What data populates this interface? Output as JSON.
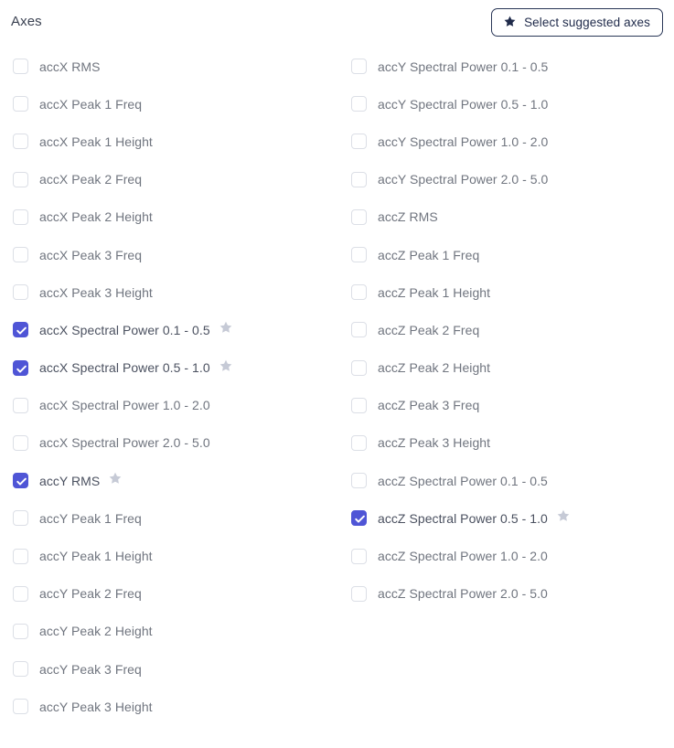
{
  "header": {
    "title": "Axes",
    "suggest_button": {
      "label": "Select suggested axes",
      "icon": "star-icon"
    }
  },
  "colors": {
    "checkbox_checked": "#4f55d6",
    "checkbox_border": "#dcdfe6",
    "label_text": "#70757f",
    "title_text": "#3b4252",
    "button_border": "#2a3757",
    "button_text": "#1f2a4a",
    "star_suggested": "#c6cad6",
    "background": "#ffffff"
  },
  "columns": [
    {
      "name": "left-column",
      "items": [
        {
          "label": "accX RMS",
          "checked": false,
          "suggested": false
        },
        {
          "label": "accX Peak 1 Freq",
          "checked": false,
          "suggested": false
        },
        {
          "label": "accX Peak 1 Height",
          "checked": false,
          "suggested": false
        },
        {
          "label": "accX Peak 2 Freq",
          "checked": false,
          "suggested": false
        },
        {
          "label": "accX Peak 2 Height",
          "checked": false,
          "suggested": false
        },
        {
          "label": "accX Peak 3 Freq",
          "checked": false,
          "suggested": false
        },
        {
          "label": "accX Peak 3 Height",
          "checked": false,
          "suggested": false
        },
        {
          "label": "accX Spectral Power 0.1 - 0.5",
          "checked": true,
          "suggested": true
        },
        {
          "label": "accX Spectral Power 0.5 - 1.0",
          "checked": true,
          "suggested": true
        },
        {
          "label": "accX Spectral Power 1.0 - 2.0",
          "checked": false,
          "suggested": false
        },
        {
          "label": "accX Spectral Power 2.0 - 5.0",
          "checked": false,
          "suggested": false
        },
        {
          "label": "accY RMS",
          "checked": true,
          "suggested": true
        },
        {
          "label": "accY Peak 1 Freq",
          "checked": false,
          "suggested": false
        },
        {
          "label": "accY Peak 1 Height",
          "checked": false,
          "suggested": false
        },
        {
          "label": "accY Peak 2 Freq",
          "checked": false,
          "suggested": false
        },
        {
          "label": "accY Peak 2 Height",
          "checked": false,
          "suggested": false
        },
        {
          "label": "accY Peak 3 Freq",
          "checked": false,
          "suggested": false
        },
        {
          "label": "accY Peak 3 Height",
          "checked": false,
          "suggested": false
        }
      ]
    },
    {
      "name": "right-column",
      "items": [
        {
          "label": "accY Spectral Power 0.1 - 0.5",
          "checked": false,
          "suggested": false
        },
        {
          "label": "accY Spectral Power 0.5 - 1.0",
          "checked": false,
          "suggested": false
        },
        {
          "label": "accY Spectral Power 1.0 - 2.0",
          "checked": false,
          "suggested": false
        },
        {
          "label": "accY Spectral Power 2.0 - 5.0",
          "checked": false,
          "suggested": false
        },
        {
          "label": "accZ RMS",
          "checked": false,
          "suggested": false
        },
        {
          "label": "accZ Peak 1 Freq",
          "checked": false,
          "suggested": false
        },
        {
          "label": "accZ Peak 1 Height",
          "checked": false,
          "suggested": false
        },
        {
          "label": "accZ Peak 2 Freq",
          "checked": false,
          "suggested": false
        },
        {
          "label": "accZ Peak 2 Height",
          "checked": false,
          "suggested": false
        },
        {
          "label": "accZ Peak 3 Freq",
          "checked": false,
          "suggested": false
        },
        {
          "label": "accZ Peak 3 Height",
          "checked": false,
          "suggested": false
        },
        {
          "label": "accZ Spectral Power 0.1 - 0.5",
          "checked": false,
          "suggested": false
        },
        {
          "label": "accZ Spectral Power 0.5 - 1.0",
          "checked": true,
          "suggested": true
        },
        {
          "label": "accZ Spectral Power 1.0 - 2.0",
          "checked": false,
          "suggested": false
        },
        {
          "label": "accZ Spectral Power 2.0 - 5.0",
          "checked": false,
          "suggested": false
        }
      ]
    }
  ]
}
